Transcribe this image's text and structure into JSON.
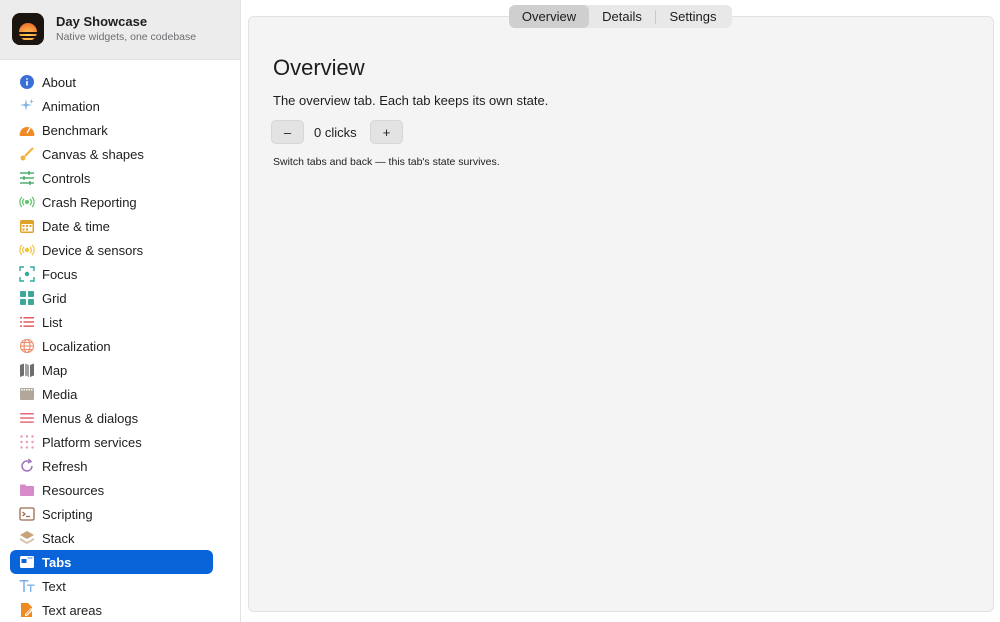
{
  "app": {
    "title": "Day Showcase",
    "subtitle": "Native widgets, one codebase"
  },
  "sidebar": {
    "items": [
      {
        "label": "About",
        "icon": "info-icon",
        "color": "#3a6fd6"
      },
      {
        "label": "Animation",
        "icon": "sparkles-icon",
        "color": "#7fb3e8"
      },
      {
        "label": "Benchmark",
        "icon": "speedometer-icon",
        "color": "#f08a24"
      },
      {
        "label": "Canvas & shapes",
        "icon": "brush-icon",
        "color": "#f0b23a"
      },
      {
        "label": "Controls",
        "icon": "sliders-icon",
        "color": "#3aa05a"
      },
      {
        "label": "Crash Reporting",
        "icon": "broadcast-icon",
        "color": "#5ac26a"
      },
      {
        "label": "Date & time",
        "icon": "calendar-icon",
        "color": "#e0a32a"
      },
      {
        "label": "Device & sensors",
        "icon": "sensor-icon",
        "color": "#f0c43a"
      },
      {
        "label": "Focus",
        "icon": "focus-icon",
        "color": "#2fa8a0"
      },
      {
        "label": "Grid",
        "icon": "grid-icon",
        "color": "#3fa79a"
      },
      {
        "label": "List",
        "icon": "list-icon",
        "color": "#e65a5a"
      },
      {
        "label": "Localization",
        "icon": "globe-icon",
        "color": "#f08a6a"
      },
      {
        "label": "Map",
        "icon": "map-icon",
        "color": "#6e6e6e"
      },
      {
        "label": "Media",
        "icon": "film-icon",
        "color": "#b0a79a"
      },
      {
        "label": "Menus & dialogs",
        "icon": "menu-icon",
        "color": "#e66a7a"
      },
      {
        "label": "Platform services",
        "icon": "dots-grid-icon",
        "color": "#e99ab0"
      },
      {
        "label": "Refresh",
        "icon": "refresh-icon",
        "color": "#9a6ab8"
      },
      {
        "label": "Resources",
        "icon": "folder-icon",
        "color": "#d78ac8"
      },
      {
        "label": "Scripting",
        "icon": "terminal-icon",
        "color": "#9a6a4a"
      },
      {
        "label": "Stack",
        "icon": "stack-icon",
        "color": "#c8a27a"
      },
      {
        "label": "Tabs",
        "icon": "tabs-icon",
        "color": "#ffffff"
      },
      {
        "label": "Text",
        "icon": "text-icon",
        "color": "#7fb3e8"
      },
      {
        "label": "Text areas",
        "icon": "doc-edit-icon",
        "color": "#f08a24"
      }
    ],
    "selected_index": 20
  },
  "tabs": {
    "items": [
      "Overview",
      "Details",
      "Settings"
    ],
    "active": "Overview"
  },
  "main": {
    "title": "Overview",
    "description": "The overview tab. Each tab keeps its own state.",
    "decrement_label": "–",
    "increment_label": "+",
    "count_label": "0 clicks",
    "hint": "Switch tabs and back — this tab's state survives."
  },
  "colors": {
    "accent": "#0a64d9",
    "panel": "#f4f4f4"
  }
}
